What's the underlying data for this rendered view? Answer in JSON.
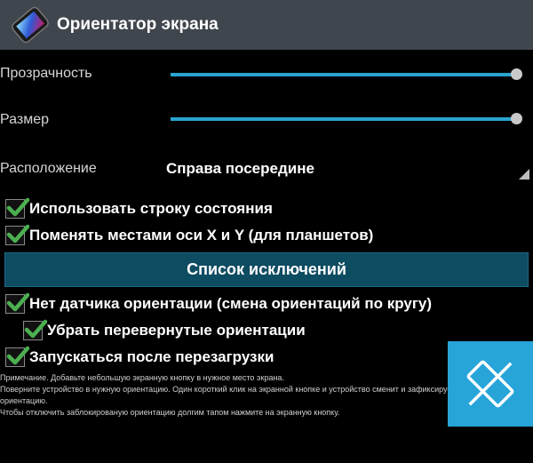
{
  "app": {
    "title": "Ориентатор экрана",
    "icon": "screen-rotation-app-icon"
  },
  "settings": {
    "transparency": {
      "label": "Прозрачность",
      "value": 1.0
    },
    "size": {
      "label": "Размер",
      "value": 1.0
    },
    "position": {
      "label": "Расположение",
      "value": "Справа посередине"
    }
  },
  "checkboxes": {
    "use_status_bar": {
      "label": "Использовать строку состояния",
      "checked": true
    },
    "swap_axes": {
      "label": "Поменять местами оси X и Y (для планшетов)",
      "checked": true
    },
    "no_sensor": {
      "label": "Нет датчика ориентации (смена ориентаций по кругу)",
      "checked": true
    },
    "remove_upside_down": {
      "label": "Убрать перевернутые ориентации",
      "checked": true
    },
    "start_on_boot": {
      "label": "Запускаться после перезагрузки",
      "checked": true
    }
  },
  "exclusions_button": {
    "label": "Список исключений"
  },
  "notes": {
    "line1": "Примечание. Добавьте небольшую экранную кнопку в нужное место экрана.",
    "line2": "Поверните устройство в нужную ориентацию. Один короткий клик на экранной кнопке и устройство сменит и зафиксирует",
    "line3": "ориентацию.",
    "line4": "Чтобы отключить заблокированую ориентацию долгим тапом нажмите на экранную кнопку."
  },
  "floating_button": {
    "icon": "rotation-lock-icon"
  },
  "colors": {
    "accent": "#2aa4d0",
    "titlebar": "#40464d",
    "check": "#4caf50",
    "button_bg": "#0e4c62",
    "floating_button": "#27a4d8"
  }
}
